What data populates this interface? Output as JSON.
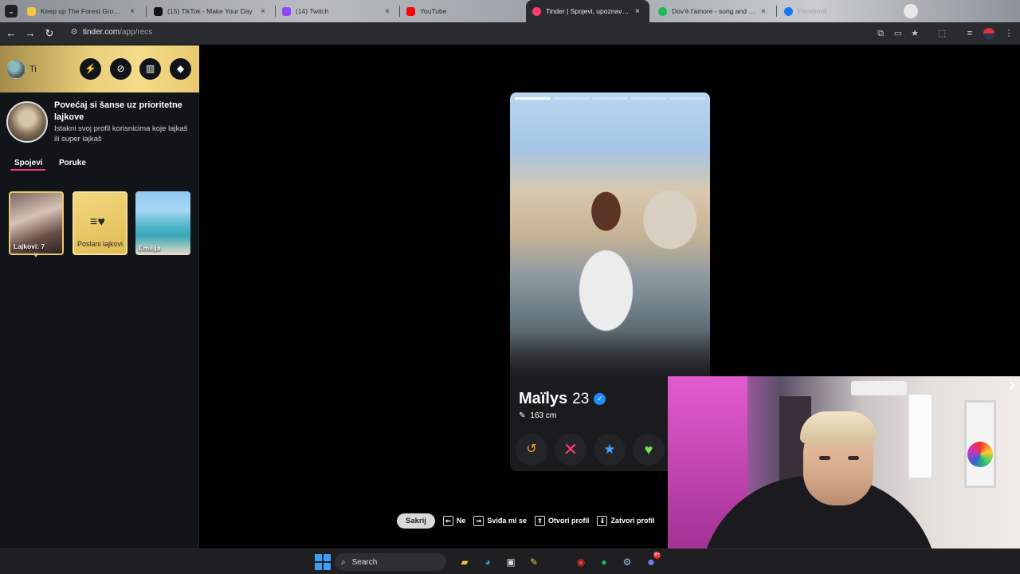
{
  "browser": {
    "tabs": [
      {
        "title": "Keep up The Forest Growing",
        "favicon_color": "#f5c542",
        "active": false
      },
      {
        "title": "(15) TikTok - Make Your Day",
        "favicon_color": "#111111",
        "active": false
      },
      {
        "title": "(14) Twitch",
        "favicon_color": "#9146ff",
        "active": false
      },
      {
        "title": "YouTube",
        "favicon_color": "#ff0000",
        "active": false
      },
      {
        "title": "Tinder | Spojevi, upoznavanje p",
        "favicon_color": "#fe3c72",
        "active": true
      },
      {
        "title": "Dov'è l'amore - song and lyrics",
        "favicon_color": "#1db954",
        "active": false
      },
      {
        "title": "Facebook",
        "favicon_color": "#1877f2",
        "active": false
      }
    ],
    "tab_close": "×",
    "url_host": "tinder.com",
    "url_path": "/app/recs"
  },
  "sidebar": {
    "me_label": "Ti",
    "header_buttons": [
      "boost-icon",
      "explore-icon",
      "briefcase-icon",
      "shield-icon"
    ],
    "promo_title": "Povećaj si šanse uz prioritetne lajkove",
    "promo_subtitle": "Istakni svoj profil korisnicima koje lajkaš ili super lajkaš",
    "tabs": [
      {
        "label": "Spojevi",
        "active": true
      },
      {
        "label": "Poruke",
        "active": false
      }
    ],
    "cards": {
      "likes_label": "Lajkovi: 7",
      "sent_label": "Poslani lajkovi",
      "match_name": "Emilija"
    }
  },
  "profile": {
    "name": "Maïlys",
    "age": "23",
    "height": "163 cm",
    "photo_count": 5,
    "current_photo": 1
  },
  "hints": {
    "hide": "Sakrij",
    "nope": "Ne",
    "like": "Sviđa mi se",
    "open": "Otvori profil",
    "close": "Zatvori profil"
  },
  "taskbar": {
    "search_label": "Search",
    "discord_badge": "9+"
  },
  "colors": {
    "brand": "#fe3c72",
    "gold": "#e8c96e",
    "super_like": "#3ca4ff",
    "like": "#7be054",
    "rewind": "#f5a623"
  }
}
